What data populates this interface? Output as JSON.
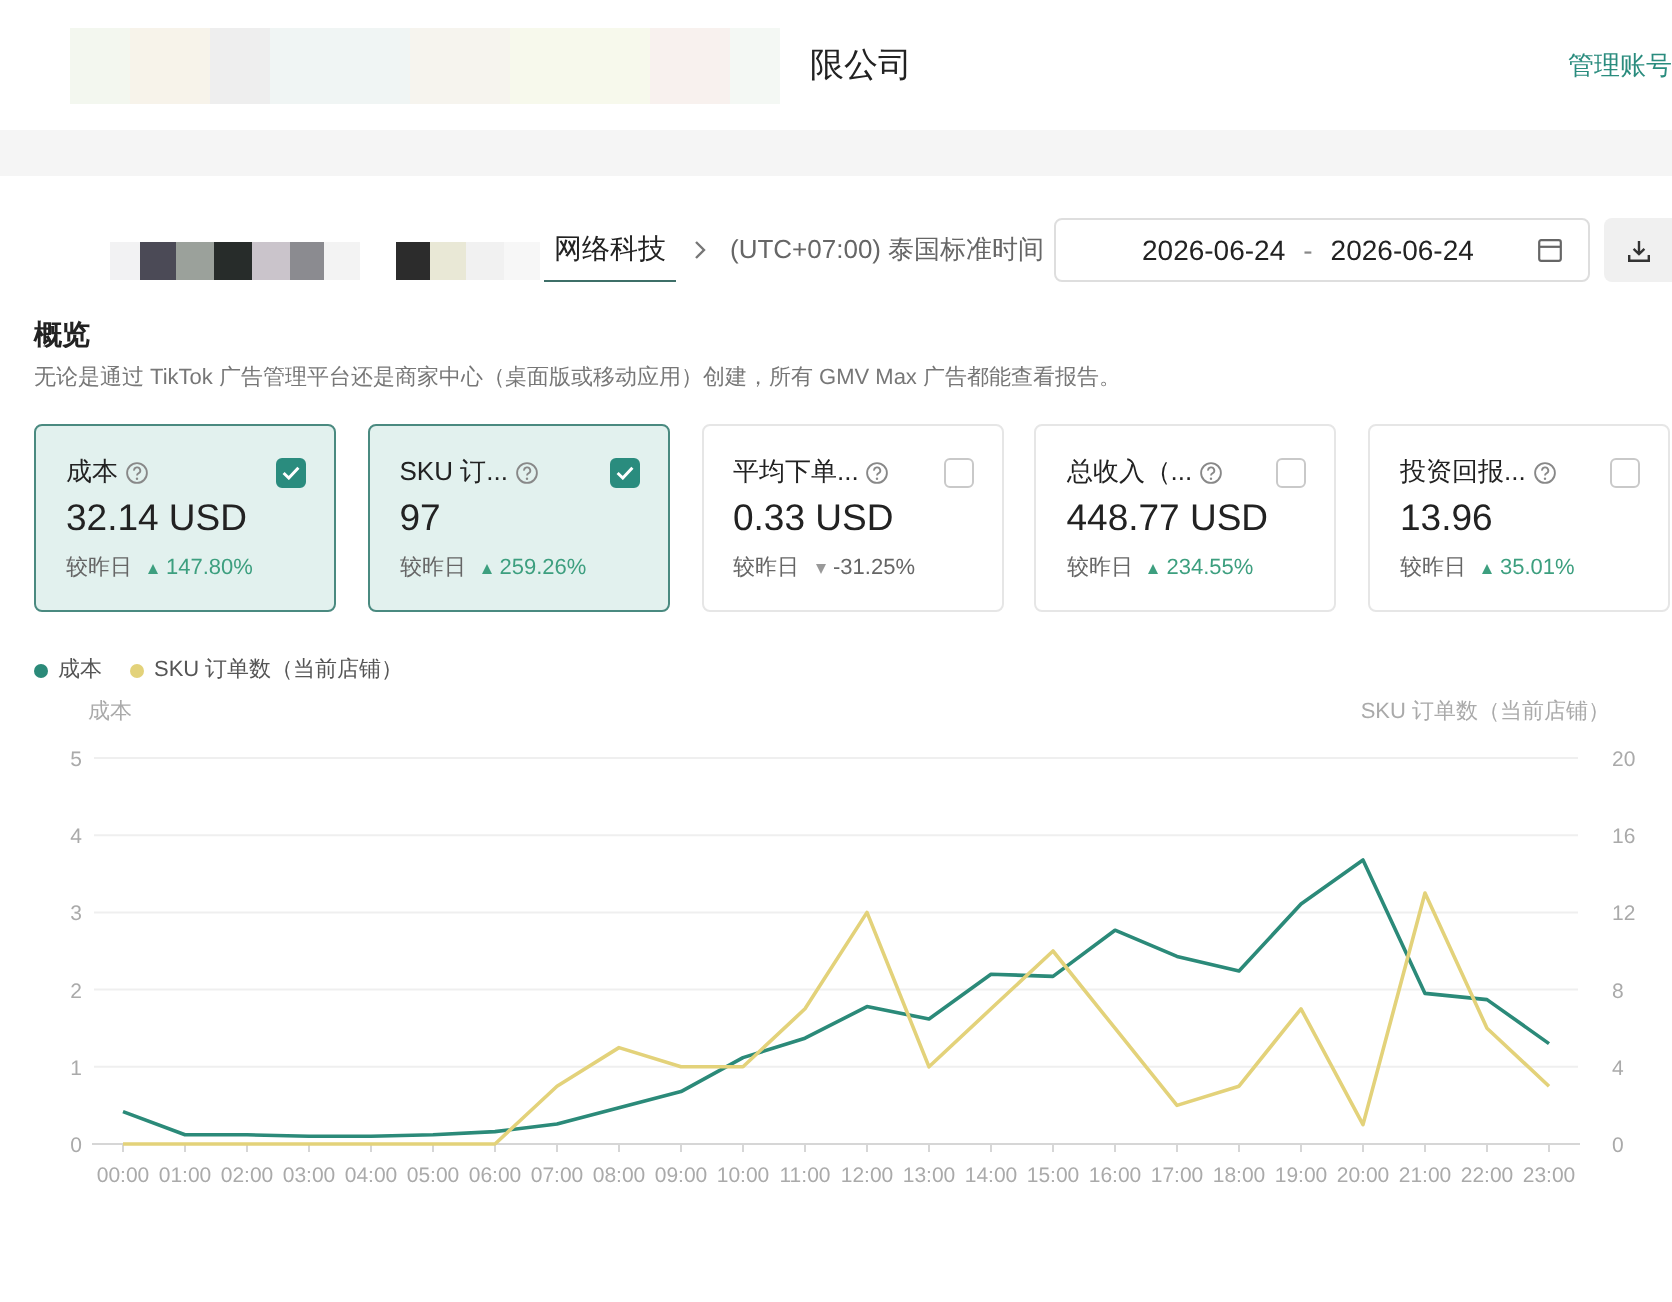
{
  "header": {
    "title": "限公司",
    "link": "管理账号"
  },
  "toolbar": {
    "shop": "网络科技",
    "timezone": "(UTC+07:00) 泰国标准时间",
    "date_range": {
      "start": "2026-06-24",
      "separator": "-",
      "end": "2026-06-24"
    }
  },
  "overview": {
    "title": "概览",
    "description": "无论是通过 TikTok 广告管理平台还是商家中心（桌面版或移动应用）创建，所有 GMV Max 广告都能查看报告。"
  },
  "metrics": [
    {
      "label": "成本",
      "value": "32.14 USD",
      "compare_label": "较昨日",
      "change": "147.80%",
      "increase": true,
      "selected": true
    },
    {
      "label": "SKU 订...",
      "value": "97",
      "compare_label": "较昨日",
      "change": "259.26%",
      "increase": true,
      "selected": true
    },
    {
      "label": "平均下单...",
      "value": "0.33 USD",
      "compare_label": "较昨日",
      "change": "-31.25%",
      "increase": false,
      "selected": false
    },
    {
      "label": "总收入（...",
      "value": "448.77 USD",
      "compare_label": "较昨日",
      "change": "234.55%",
      "increase": true,
      "selected": false
    },
    {
      "label": "投资回报...",
      "value": "13.96",
      "compare_label": "较昨日",
      "change": "35.01%",
      "increase": true,
      "selected": false
    }
  ],
  "chart": {
    "chart_data": {
      "type": "line",
      "ylabel": "成本",
      "y2label": "SKU 订单数（当前店铺）",
      "grid": true,
      "legend": "top-left",
      "categories": [
        "00:00",
        "01:00",
        "02:00",
        "03:00",
        "04:00",
        "05:00",
        "06:00",
        "07:00",
        "08:00",
        "09:00",
        "10:00",
        "11:00",
        "12:00",
        "13:00",
        "14:00",
        "15:00",
        "16:00",
        "17:00",
        "18:00",
        "19:00",
        "20:00",
        "21:00",
        "22:00",
        "23:00"
      ],
      "ylim": [
        0,
        5
      ],
      "yticks": [
        0,
        1,
        2,
        3,
        4,
        5
      ],
      "y2lim": [
        0,
        20
      ],
      "y2ticks": [
        0,
        4,
        8,
        12,
        16,
        20
      ],
      "series": [
        {
          "name": "成本",
          "color": "#2b8a79",
          "values": [
            0.42,
            0.12,
            0.12,
            0.1,
            0.1,
            0.12,
            0.16,
            0.26,
            0.47,
            0.68,
            1.12,
            1.37,
            1.78,
            1.62,
            2.2,
            2.17,
            2.77,
            2.43,
            2.24,
            3.11,
            3.68,
            1.95,
            1.87,
            1.3
          ]
        },
        {
          "name": "SKU 订单数（当前店铺）",
          "color": "#e3d27a",
          "axis": "y2",
          "values": [
            0,
            0,
            0,
            0,
            0,
            0,
            0,
            3,
            5,
            4,
            4,
            7,
            12,
            4,
            7,
            10,
            6,
            2,
            3,
            7,
            1,
            13,
            6,
            3
          ]
        }
      ]
    }
  }
}
